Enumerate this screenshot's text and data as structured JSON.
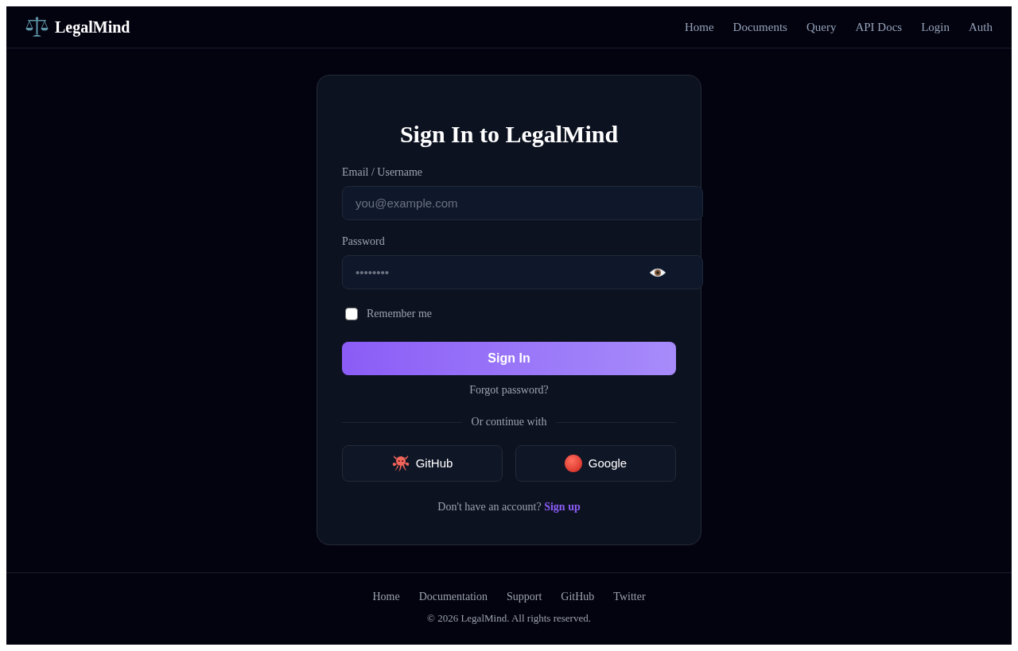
{
  "header": {
    "brand": "LegalMind",
    "nav": [
      "Home",
      "Documents",
      "Query",
      "API Docs",
      "Login",
      "Auth"
    ]
  },
  "login_card": {
    "title": "Sign In to LegalMind",
    "fields": [
      {
        "kind": "text",
        "label": "Email / Username",
        "placeholder": "you@example.com"
      },
      {
        "kind": "password",
        "label": "Password",
        "placeholder": "••••••••"
      }
    ],
    "remember": {
      "label": "Remember me",
      "checked": false
    },
    "submit": "Sign In",
    "forgot_link": "Forgot password?",
    "divider": "Or continue with",
    "social_buttons": [
      {
        "kind": "github",
        "label": "GitHub"
      },
      {
        "kind": "google",
        "label": "Google"
      }
    ],
    "signup": {
      "prompt": "Don't have an account?",
      "link": "Sign up"
    }
  },
  "footer": {
    "links": [
      "Home",
      "Documentation",
      "Support",
      "GitHub",
      "Twitter"
    ],
    "copyright": "© 2026 LegalMind. All rights reserved."
  }
}
